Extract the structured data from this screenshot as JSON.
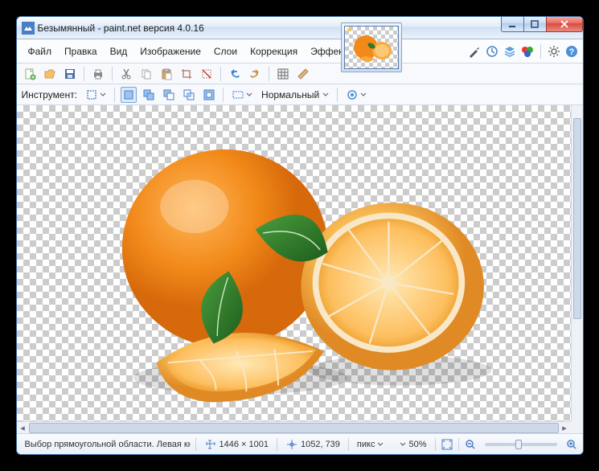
{
  "window_title": "Безымянный - paint.net версия 4.0.16",
  "menubar": [
    "Файл",
    "Правка",
    "Вид",
    "Изображение",
    "Слои",
    "Коррекция",
    "Эффекты"
  ],
  "top_icons": {
    "arrow": "arrow",
    "clock": "history",
    "layers": "layers",
    "palette": "colors",
    "gear": "settings",
    "help": "help"
  },
  "toolbar": {
    "instrument_label": "Инструмент:",
    "mode_label": "Нормальный"
  },
  "status": {
    "hint": "Выбор прямоугольной области. Левая кнопка - выделе…",
    "dims": "1446 × 1001",
    "cursor": "1052, 739",
    "units": "пикс",
    "zoom": "50%"
  },
  "thumb_star": "★"
}
